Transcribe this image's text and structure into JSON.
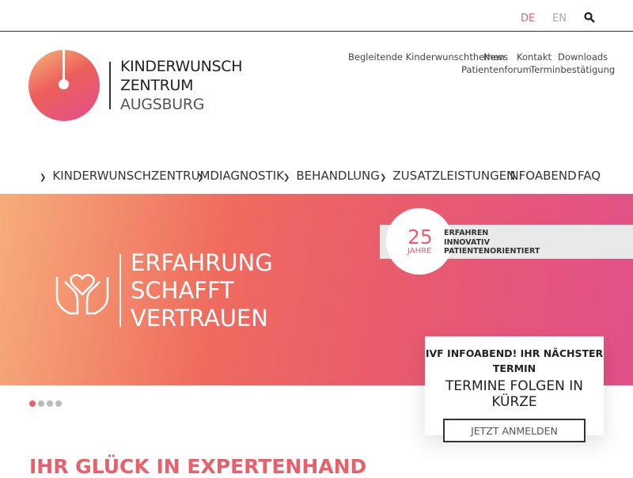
{
  "topbar": {
    "languages": [
      "DE",
      "EN"
    ],
    "active_language": "DE",
    "search_icon": "search-icon"
  },
  "logo": {
    "line1": "KINDERWUNSCH",
    "line2": "ZENTRUM",
    "line3": "AUGSBURG"
  },
  "meta_nav": [
    "Begleitende Kinderwunschthemen",
    "News",
    "Kontakt",
    "Downloads",
    "Patientenforum",
    "Terminbestätigung"
  ],
  "main_nav": [
    {
      "label": "KINDERWUNSCHZENTRUM",
      "dropdown": true
    },
    {
      "label": "DIAGNOSTIK",
      "dropdown": true
    },
    {
      "label": "BEHANDLUNG",
      "dropdown": true
    },
    {
      "label": "ZUSATZLEISTUNGEN",
      "dropdown": true
    },
    {
      "label": "INFOABEND",
      "dropdown": false
    },
    {
      "label": "FAQ",
      "dropdown": false
    }
  ],
  "hero": {
    "lines": [
      "ERFAHRUNG",
      "SCHAFFT",
      "VERTRAUEN"
    ],
    "badge_number": "25",
    "badge_unit": "JAHRE",
    "badge_lines": [
      "ERFAHREN",
      "INNOVATIV",
      "PATIENTENORIENTIERT"
    ],
    "slide_count": 4,
    "active_slide": 1
  },
  "card": {
    "title": "IVF INFOABEND! IHR NÄCHSTER TERMIN",
    "subtitle": "TERMINE FOLGEN IN KÜRZE",
    "button": "JETZT ANMELDEN"
  },
  "heading": "IHR GLÜCK IN EXPERTENHAND",
  "colors": {
    "accent": "#e8606a",
    "text": "#333333"
  }
}
